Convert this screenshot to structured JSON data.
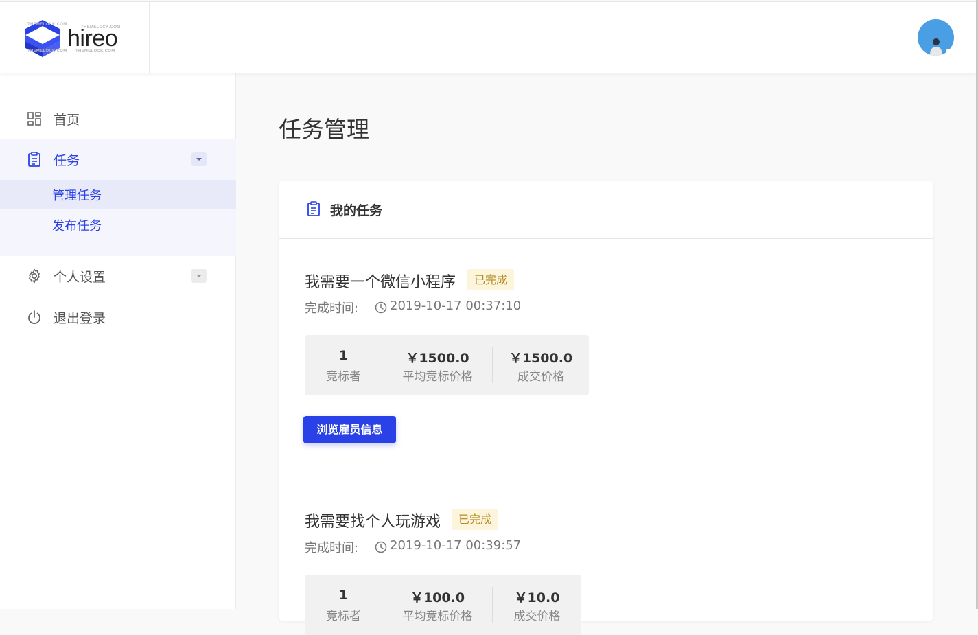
{
  "brand": {
    "name": "hireo",
    "watermark": "THEMELOCK.COM",
    "accent": "#2a41e8"
  },
  "sidebar": {
    "items": [
      {
        "label": "首页",
        "icon": "dashboard-icon"
      },
      {
        "label": "任务",
        "icon": "clipboard-icon",
        "expanded": true,
        "children": [
          {
            "label": "管理任务",
            "selected": true
          },
          {
            "label": "发布任务"
          }
        ]
      },
      {
        "label": "个人设置",
        "icon": "gear-icon"
      },
      {
        "label": "退出登录",
        "icon": "power-icon"
      }
    ]
  },
  "page": {
    "title": "任务管理"
  },
  "card": {
    "title": "我的任务",
    "time_label": "完成时间:",
    "tasks": [
      {
        "title": "我需要一个微信小程序",
        "status": "已完成",
        "time": "2019-10-17 00:37:10",
        "bidders": "1",
        "bidders_label": "竞标者",
        "avg_price": "￥1500.0",
        "avg_price_label": "平均竞标价格",
        "deal_price": "￥1500.0",
        "deal_price_label": "成交价格",
        "button": "浏览雇员信息"
      },
      {
        "title": "我需要找个人玩游戏",
        "status": "已完成",
        "time": "2019-10-17 00:39:57",
        "bidders": "1",
        "bidders_label": "竞标者",
        "avg_price": "￥100.0",
        "avg_price_label": "平均竞标价格",
        "deal_price": "￥10.0",
        "deal_price_label": "成交价格"
      }
    ]
  }
}
